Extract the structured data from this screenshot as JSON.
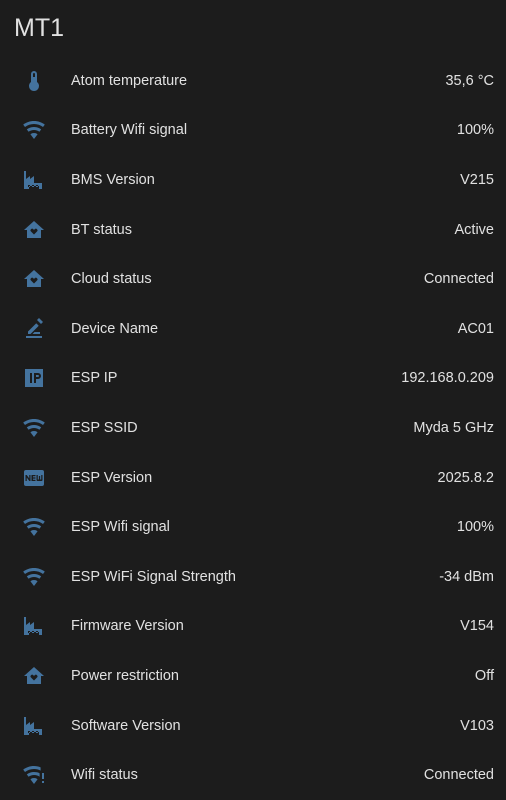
{
  "card": {
    "title": "MT1"
  },
  "entities": [
    {
      "icon": "thermometer-icon",
      "name": "Atom temperature",
      "value": "35,6 °C"
    },
    {
      "icon": "wifi-icon",
      "name": "Battery Wifi signal",
      "value": "100%"
    },
    {
      "icon": "factory-icon",
      "name": "BMS Version",
      "value": "V215"
    },
    {
      "icon": "home-heart-icon",
      "name": "BT status",
      "value": "Active"
    },
    {
      "icon": "home-heart-icon",
      "name": "Cloud status",
      "value": "Connected"
    },
    {
      "icon": "rename-pencil-icon",
      "name": "Device Name",
      "value": "AC01"
    },
    {
      "icon": "ip-icon",
      "name": "ESP IP",
      "value": "192.168.0.209"
    },
    {
      "icon": "wifi-icon",
      "name": "ESP SSID",
      "value": "Myda 5 GHz"
    },
    {
      "icon": "new-box-icon",
      "name": "ESP Version",
      "value": "2025.8.2"
    },
    {
      "icon": "wifi-icon",
      "name": "ESP Wifi signal",
      "value": "100%"
    },
    {
      "icon": "wifi-icon",
      "name": "ESP WiFi Signal Strength",
      "value": "-34 dBm"
    },
    {
      "icon": "factory-icon",
      "name": "Firmware Version",
      "value": "V154"
    },
    {
      "icon": "home-heart-icon",
      "name": "Power restriction",
      "value": "Off"
    },
    {
      "icon": "factory-icon",
      "name": "Software Version",
      "value": "V103"
    },
    {
      "icon": "wifi-alert-icon",
      "name": "Wifi status",
      "value": "Connected"
    }
  ],
  "colors": {
    "background": "#1c1c1c",
    "text": "#e1e1e1",
    "icon": "#44739e"
  }
}
